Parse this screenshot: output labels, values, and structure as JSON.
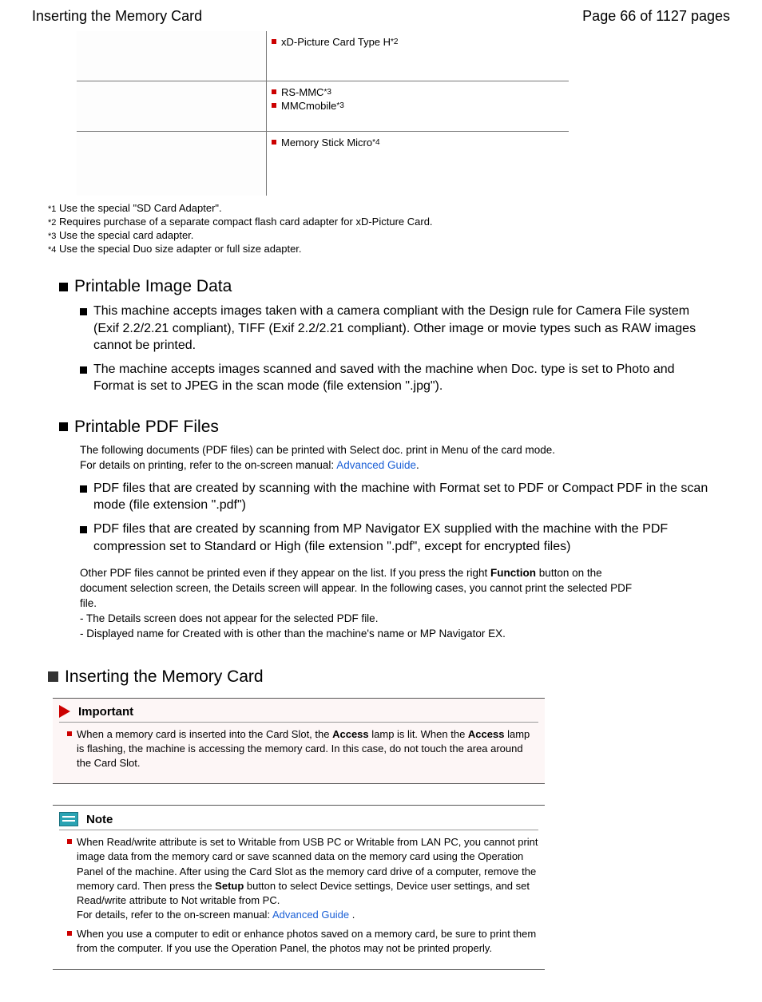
{
  "header": {
    "title": "Inserting the Memory Card",
    "page_indicator": "Page 66 of 1127 pages"
  },
  "table_rows": [
    {
      "items": [
        {
          "label": "xD-Picture Card Type H",
          "sup": "*2"
        }
      ]
    },
    {
      "items": [
        {
          "label": "RS-MMC",
          "sup": "*3"
        },
        {
          "label": "MMCmobile",
          "sup": "*3"
        }
      ]
    },
    {
      "items": [
        {
          "label": "Memory Stick Micro",
          "sup": "*4"
        }
      ]
    }
  ],
  "footnotes": {
    "f1_num": "*1",
    "f1_text": "Use the special \"SD Card Adapter\".",
    "f2_num": "*2",
    "f2_text": "Requires purchase of a separate compact flash card adapter for xD-Picture Card.",
    "f3_num": "*3",
    "f3_text": "Use the special card adapter.",
    "f4_num": "*4",
    "f4_text": "Use the special Duo size adapter or full size adapter."
  },
  "section_printable_image": {
    "title": "Printable Image Data",
    "li1": "This machine accepts images taken with a camera compliant with the Design rule for Camera File system (Exif 2.2/2.21 compliant), TIFF (Exif 2.2/2.21 compliant). Other image or movie types such as RAW images cannot be printed.",
    "li2": "The machine accepts images scanned and saved with the machine when Doc. type is set to Photo and Format is set to JPEG in the scan mode (file extension \".jpg\")."
  },
  "section_printable_pdf": {
    "title": "Printable PDF Files",
    "intro1": "The following documents (PDF files) can be printed with Select doc. print in Menu of the card mode.",
    "intro2_pre": "For details on printing, refer to the on-screen manual: ",
    "intro2_link": "Advanced Guide",
    "intro2_post": ".",
    "li1": "PDF files that are created by scanning with the machine with Format set to PDF or Compact PDF in the scan mode (file extension \".pdf\")",
    "li2": "PDF files that are created by scanning from MP Navigator EX supplied with the machine with the PDF compression set to Standard or High (file extension \".pdf\", except for encrypted files)",
    "other_pre": "Other PDF files cannot be printed even if they appear on the list. If you press the right ",
    "other_function": "Function",
    "other_post": " button on the document selection screen, the Details screen will appear. In the following cases, you cannot print the selected PDF file.",
    "case1": "- The Details screen does not appear for the selected PDF file.",
    "case2": "- Displayed name for Created with is other than the machine's name or MP Navigator EX."
  },
  "section_inserting": {
    "title": "Inserting the Memory Card"
  },
  "important": {
    "heading": "Important",
    "text_pre": "When a memory card is inserted into the Card Slot, the ",
    "access1": "Access",
    "text_mid": " lamp is lit. When the ",
    "access2": "Access",
    "text_post": " lamp is flashing, the machine is accessing the memory card. In this case, do not touch the area around the Card Slot."
  },
  "note": {
    "heading": "Note",
    "li1_pre": "When Read/write attribute is set to Writable from USB PC or Writable from LAN PC, you cannot print image data from the memory card or save scanned data on the memory card using the Operation Panel of the machine. After using the Card Slot as the memory card drive of a computer, remove the memory card. Then press the ",
    "li1_setup": "Setup",
    "li1_post": " button to select Device settings, Device user settings, and set Read/write attribute to Not writable from PC.",
    "li1_detail_pre": "For details, refer to the on-screen manual: ",
    "li1_detail_link": "Advanced Guide",
    "li1_detail_post": " .",
    "li2": "When you use a computer to edit or enhance photos saved on a memory card, be sure to print them from the computer. If you use the Operation Panel, the photos may not be printed properly."
  }
}
